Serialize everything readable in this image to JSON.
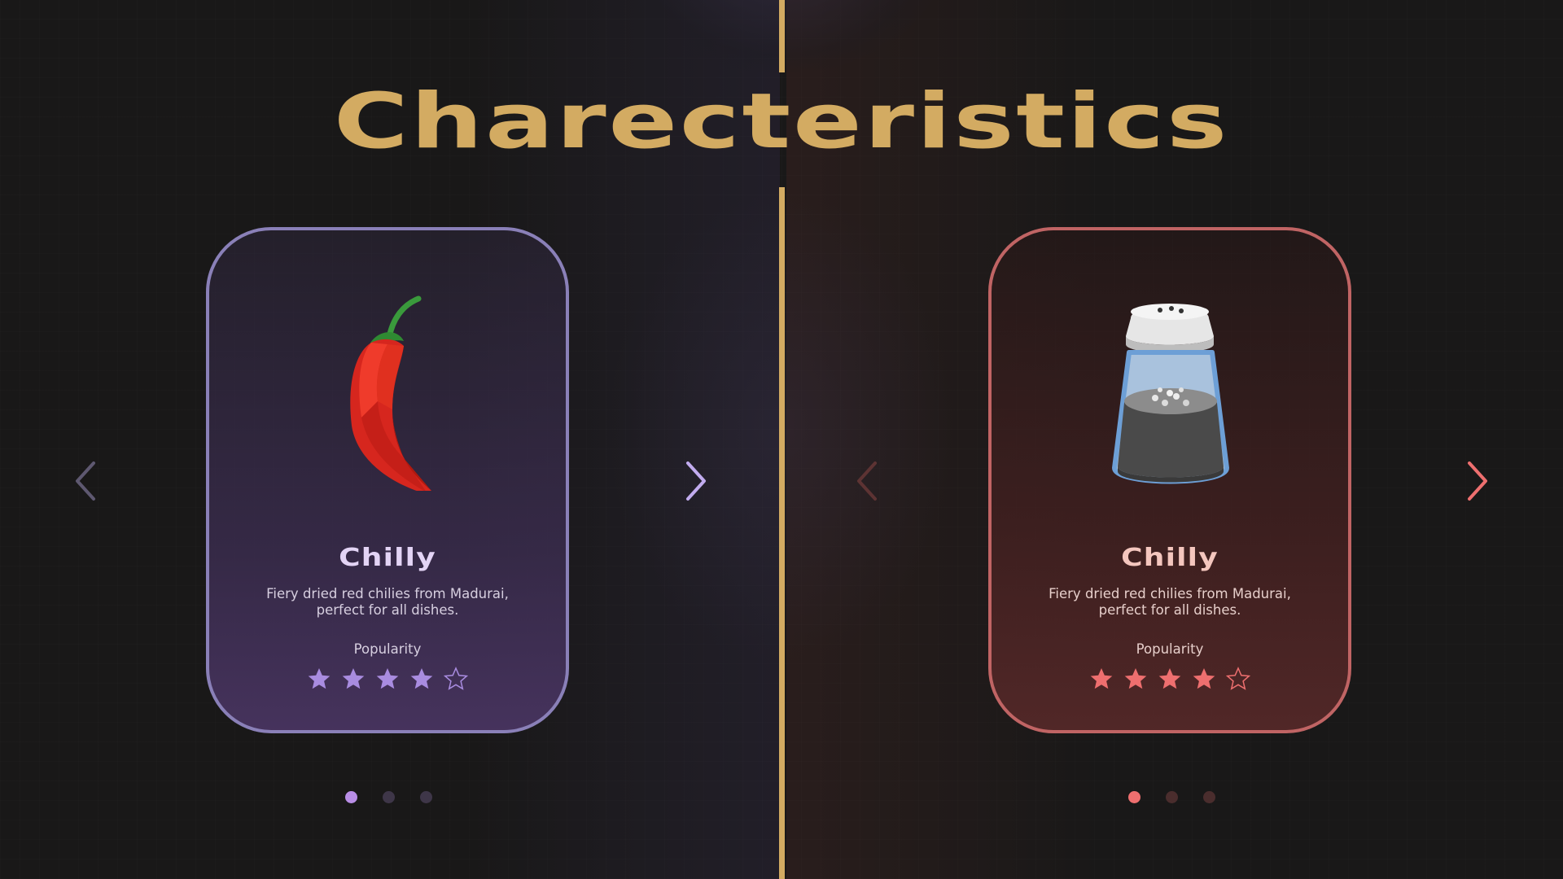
{
  "page": {
    "title": "Charecteristics",
    "accent_color": "#d3ab62"
  },
  "left_panel": {
    "theme_color": "#a98ce0",
    "prev_arrow": {
      "icon": "chevron-left-icon",
      "color": "#5e5870"
    },
    "next_arrow": {
      "icon": "chevron-right-icon",
      "color": "#c2acef"
    },
    "card": {
      "image": "chili-pepper-image",
      "name": "Chilly",
      "description": "Fiery dried red chilies from Madurai, perfect for all dishes.",
      "popularity_label": "Popularity",
      "rating": 4,
      "rating_max": 5
    },
    "pagination": {
      "count": 3,
      "active_index": 0,
      "active_color": "#b98ee6",
      "inactive_color": "#3e3648"
    }
  },
  "right_panel": {
    "theme_color": "#ee6f6f",
    "prev_arrow": {
      "icon": "chevron-left-icon",
      "color": "#5d3333"
    },
    "next_arrow": {
      "icon": "chevron-right-icon",
      "color": "#ee6f6f"
    },
    "card": {
      "image": "salt-shaker-image",
      "name": "Chilly",
      "description": "Fiery dried red chilies from Madurai, perfect for all dishes.",
      "popularity_label": "Popularity",
      "rating": 4,
      "rating_max": 5
    },
    "pagination": {
      "count": 3,
      "active_index": 0,
      "active_color": "#ee6f6f",
      "inactive_color": "#4a2d2d"
    }
  }
}
